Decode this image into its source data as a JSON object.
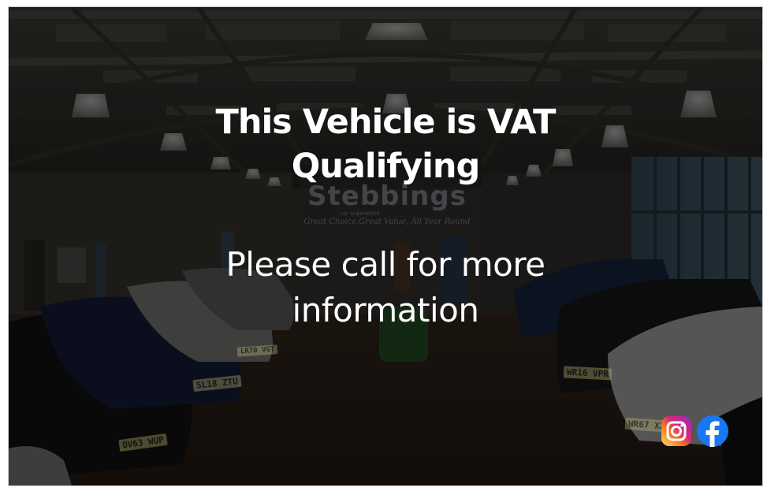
{
  "overlay": {
    "headline": [
      "This Vehicle is VAT",
      "Qualifying"
    ],
    "subline": [
      "Please call for more",
      "information"
    ]
  },
  "background": {
    "dealer_name": "Stebbings",
    "dealer_tag": "car superstore",
    "dealer_slogan": "Great Choice.Great Value, All Year Round",
    "plates": [
      "OV63 WUP",
      "SL18 ZTU",
      "WR16 VPR",
      "WR67 XXX",
      "LR70 VGT"
    ]
  },
  "social": [
    {
      "name": "Instagram",
      "icon": "instagram-icon",
      "colors": [
        "#feda75",
        "#d62976",
        "#962fbf"
      ]
    },
    {
      "name": "Facebook",
      "icon": "facebook-icon",
      "color": "#1877f2"
    }
  ]
}
